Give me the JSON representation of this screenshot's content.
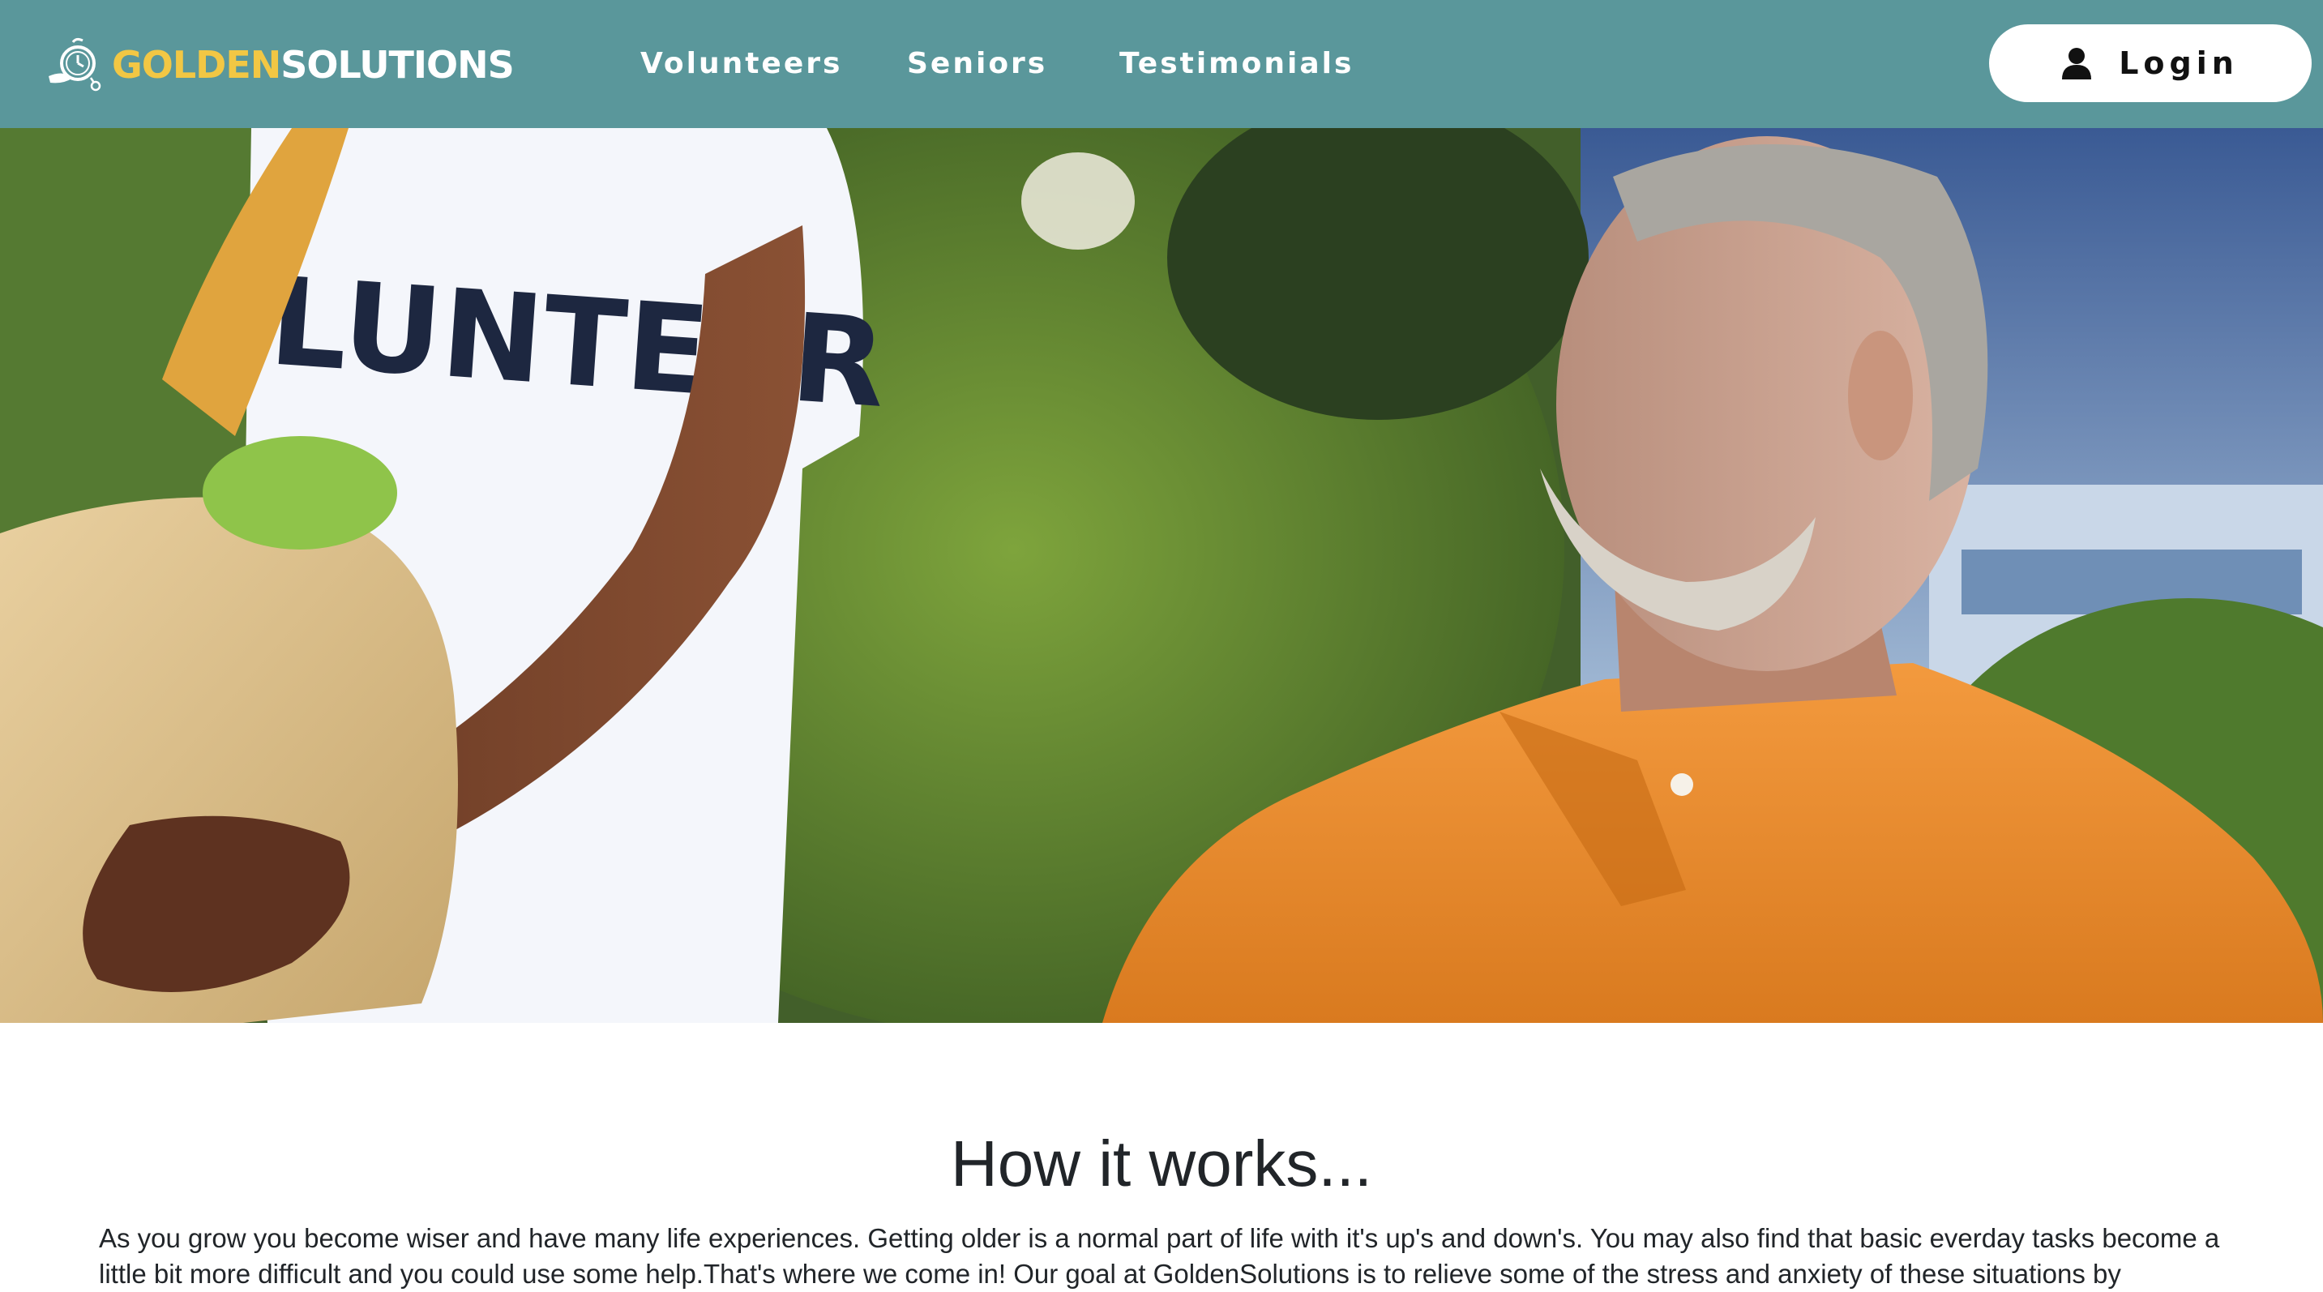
{
  "brand": {
    "name_part1": "GOLDEN",
    "name_part2": "SOLUTIONS",
    "gold_color": "#f2c744",
    "icon": "clock-bird-logo-icon"
  },
  "nav": {
    "background_color": "#5a979b",
    "links": [
      "Volunteers",
      "Seniors",
      "Testimonials"
    ],
    "login_label": "Login",
    "login_icon": "user-icon"
  },
  "hero": {
    "shirt_text": "LUNTEER",
    "description_icon": "hero-photo"
  },
  "section": {
    "title": "How it works...",
    "body": "As you grow you become wiser and have many life experiences. Getting older is a normal part of life with it's up's and down's. You may also find that basic everday tasks become a little bit more difficult and you could use some help.That's where we come in! Our goal at GoldenSolutions is to relieve some of the stress and anxiety of these situations by"
  }
}
